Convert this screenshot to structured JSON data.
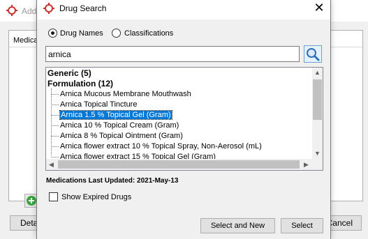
{
  "background_window": {
    "title": "Add",
    "column_header": "Medica",
    "details_button": "Details",
    "cancel_button": "Cancel"
  },
  "dialog": {
    "title": "Drug Search",
    "close_glyph": "✕",
    "search_mode": {
      "options": [
        "Drug Names",
        "Classifications"
      ],
      "selected": "Drug Names"
    },
    "search_input_value": "arnica",
    "results": {
      "groups": [
        {
          "label": "Generic (5)",
          "expanded": false
        },
        {
          "label": "Formulation (12)",
          "expanded": true
        }
      ],
      "items": [
        "Arnica  Mucous Membrane Mouthwash",
        "Arnica  Topical Tincture",
        "Arnica 1.5 % Topical Gel (Gram)",
        "Arnica 10 % Topical Cream (Gram)",
        "Arnica 8 % Topical Ointment (Gram)",
        "Arnica flower extract 10 % Topical Spray, Non-Aerosol (mL)",
        "Arnica flower extract 15 % Topical Gel (Gram)"
      ],
      "selected_item": "Arnica 1.5 % Topical Gel (Gram)"
    },
    "medications_last_updated": "Medications Last Updated: 2021-May-13",
    "show_expired_label": "Show Expired Drugs",
    "show_expired_checked": false,
    "buttons": {
      "select_and_new": "Select and New",
      "select": "Select"
    }
  },
  "colors": {
    "selection": "#0078d7",
    "logo_red": "#c8322a",
    "add_green": "#3aa53a",
    "search_icon_blue": "#2f6fb8"
  },
  "icons": [
    "app-logo-icon",
    "close-icon",
    "search-icon",
    "add-icon",
    "scroll-up-arrow-icon",
    "scroll-down-arrow-icon",
    "scroll-left-arrow-icon",
    "scroll-right-arrow-icon"
  ]
}
